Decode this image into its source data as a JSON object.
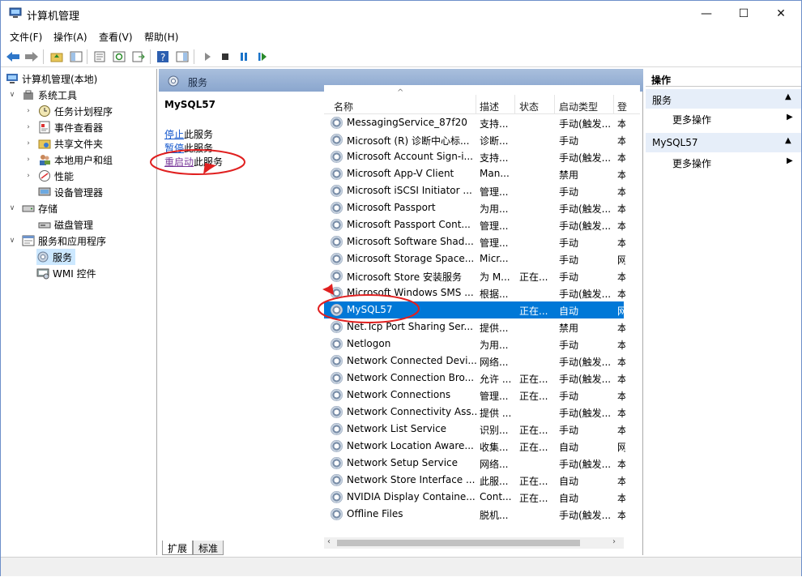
{
  "window": {
    "title": "计算机管理",
    "controls": {
      "minimize": "—",
      "maximize": "☐",
      "close": "✕"
    }
  },
  "menu": [
    {
      "label": "文件(F)"
    },
    {
      "label": "操作(A)"
    },
    {
      "label": "查看(V)"
    },
    {
      "label": "帮助(H)"
    }
  ],
  "tree": {
    "root": "计算机管理(本地)",
    "items": [
      {
        "label": "系统工具",
        "icon": "tools-icon"
      },
      {
        "label": "任务计划程序",
        "icon": "clock-icon"
      },
      {
        "label": "事件查看器",
        "icon": "event-viewer-icon"
      },
      {
        "label": "共享文件夹",
        "icon": "shared-folder-icon"
      },
      {
        "label": "本地用户和组",
        "icon": "users-icon"
      },
      {
        "label": "性能",
        "icon": "performance-icon"
      },
      {
        "label": "设备管理器",
        "icon": "device-manager-icon"
      },
      {
        "label": "存储",
        "icon": "storage-icon"
      },
      {
        "label": "磁盘管理",
        "icon": "disk-icon"
      },
      {
        "label": "服务和应用程序",
        "icon": "services-apps-icon"
      },
      {
        "label": "服务",
        "icon": "services-icon"
      },
      {
        "label": "WMI 控件",
        "icon": "wmi-icon"
      }
    ]
  },
  "services_panel": {
    "header": "服务",
    "selected_name": "MySQL57",
    "stop_link": "停止",
    "stop_suffix": "此服务",
    "pause_link": "暂停",
    "pause_suffix": "此服务",
    "restart_link": "重启动",
    "restart_suffix": "此服务",
    "columns": [
      "名称",
      "描述",
      "状态",
      "启动类型",
      "登"
    ],
    "rows": [
      {
        "name": "MessagingService_87f20",
        "desc": "支持...",
        "status": "",
        "startup": "手动(触发...",
        "logon": "本"
      },
      {
        "name": "Microsoft (R) 诊断中心标...",
        "desc": "诊断...",
        "status": "",
        "startup": "手动",
        "logon": "本"
      },
      {
        "name": "Microsoft Account Sign-i...",
        "desc": "支持...",
        "status": "",
        "startup": "手动(触发...",
        "logon": "本"
      },
      {
        "name": "Microsoft App-V Client",
        "desc": "Man...",
        "status": "",
        "startup": "禁用",
        "logon": "本"
      },
      {
        "name": "Microsoft iSCSI Initiator ...",
        "desc": "管理...",
        "status": "",
        "startup": "手动",
        "logon": "本"
      },
      {
        "name": "Microsoft Passport",
        "desc": "为用...",
        "status": "",
        "startup": "手动(触发...",
        "logon": "本"
      },
      {
        "name": "Microsoft Passport Cont...",
        "desc": "管理...",
        "status": "",
        "startup": "手动(触发...",
        "logon": "本"
      },
      {
        "name": "Microsoft Software Shad...",
        "desc": "管理...",
        "status": "",
        "startup": "手动",
        "logon": "本"
      },
      {
        "name": "Microsoft Storage Space...",
        "desc": "Micr...",
        "status": "",
        "startup": "手动",
        "logon": "网"
      },
      {
        "name": "Microsoft Store 安装服务",
        "desc": "为 M...",
        "status": "正在...",
        "startup": "手动",
        "logon": "本"
      },
      {
        "name": "Microsoft Windows SMS ...",
        "desc": "根据...",
        "status": "",
        "startup": "手动(触发...",
        "logon": "本"
      },
      {
        "name": "MySQL57",
        "desc": "",
        "status": "正在...",
        "startup": "自动",
        "logon": "网"
      },
      {
        "name": "Net.Tcp Port Sharing Ser...",
        "desc": "提供...",
        "status": "",
        "startup": "禁用",
        "logon": "本"
      },
      {
        "name": "Netlogon",
        "desc": "为用...",
        "status": "",
        "startup": "手动",
        "logon": "本"
      },
      {
        "name": "Network Connected Devi...",
        "desc": "网络...",
        "status": "",
        "startup": "手动(触发...",
        "logon": "本"
      },
      {
        "name": "Network Connection Bro...",
        "desc": "允许 ...",
        "status": "正在...",
        "startup": "手动(触发...",
        "logon": "本"
      },
      {
        "name": "Network Connections",
        "desc": "管理...",
        "status": "正在...",
        "startup": "手动",
        "logon": "本"
      },
      {
        "name": "Network Connectivity Ass...",
        "desc": "提供 ...",
        "status": "",
        "startup": "手动(触发...",
        "logon": "本"
      },
      {
        "name": "Network List Service",
        "desc": "识别...",
        "status": "正在...",
        "startup": "手动",
        "logon": "本"
      },
      {
        "name": "Network Location Aware...",
        "desc": "收集...",
        "status": "正在...",
        "startup": "自动",
        "logon": "网"
      },
      {
        "name": "Network Setup Service",
        "desc": "网络...",
        "status": "",
        "startup": "手动(触发...",
        "logon": "本"
      },
      {
        "name": "Network Store Interface ...",
        "desc": "此服...",
        "status": "正在...",
        "startup": "自动",
        "logon": "本"
      },
      {
        "name": "NVIDIA Display Containe...",
        "desc": "Cont...",
        "status": "正在...",
        "startup": "自动",
        "logon": "本"
      },
      {
        "name": "Offline Files",
        "desc": "脱机...",
        "status": "",
        "startup": "手动(触发...",
        "logon": "本"
      }
    ],
    "selected_row_index": 11,
    "tabs": [
      "扩展",
      "标准"
    ]
  },
  "actions": {
    "title": "操作",
    "sections": [
      {
        "header": "服务",
        "more": "更多操作"
      },
      {
        "header": "MySQL57",
        "more": "更多操作"
      }
    ]
  }
}
